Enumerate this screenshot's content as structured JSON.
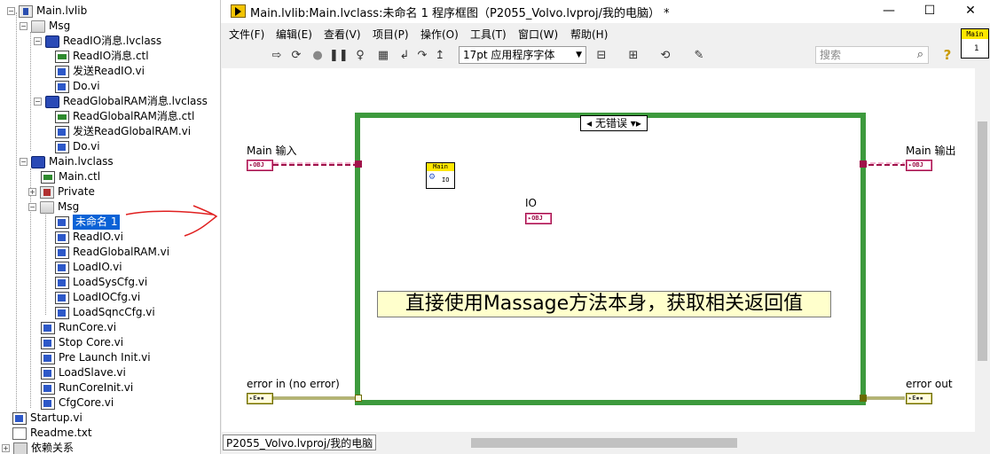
{
  "tree": {
    "items": [
      {
        "label": "Main.lvlib"
      },
      {
        "label": "Msg"
      },
      {
        "label": "ReadIO消息.lvclass"
      },
      {
        "label": "ReadIO消息.ctl"
      },
      {
        "label": "发送ReadIO.vi"
      },
      {
        "label": "Do.vi"
      },
      {
        "label": "ReadGlobalRAM消息.lvclass"
      },
      {
        "label": "ReadGlobalRAM消息.ctl"
      },
      {
        "label": "发送ReadGlobalRAM.vi"
      },
      {
        "label": "Do.vi"
      },
      {
        "label": "Main.lvclass"
      },
      {
        "label": "Main.ctl"
      },
      {
        "label": "Private"
      },
      {
        "label": "Msg"
      },
      {
        "label": "未命名 1"
      },
      {
        "label": "ReadIO.vi"
      },
      {
        "label": "ReadGlobalRAM.vi"
      },
      {
        "label": "LoadIO.vi"
      },
      {
        "label": "LoadSysCfg.vi"
      },
      {
        "label": "LoadIOCfg.vi"
      },
      {
        "label": "LoadSqncCfg.vi"
      },
      {
        "label": "RunCore.vi"
      },
      {
        "label": "Stop Core.vi"
      },
      {
        "label": "Pre Launch Init.vi"
      },
      {
        "label": "LoadSlave.vi"
      },
      {
        "label": "RunCoreInit.vi"
      },
      {
        "label": "CfgCore.vi"
      },
      {
        "label": "Startup.vi"
      },
      {
        "label": "Readme.txt"
      },
      {
        "label": "依赖关系"
      }
    ]
  },
  "window": {
    "title": "Main.lvlib:Main.lvclass:未命名 1 程序框图（P2055_Volvo.lvproj/我的电脑）  *",
    "minimize": "—",
    "maximize": "☐",
    "close": "✕"
  },
  "menubar": {
    "items": [
      "文件(F)",
      "编辑(E)",
      "查看(V)",
      "项目(P)",
      "操作(O)",
      "工具(T)",
      "窗口(W)",
      "帮助(H)"
    ]
  },
  "toolbar": {
    "font": "17pt 应用程序字体",
    "search_placeholder": "搜索",
    "help": "?"
  },
  "vi_icon": {
    "header": "Main",
    "number": "1"
  },
  "diagram": {
    "case_selector": "◂ 无错误 ▾▸",
    "main_in_label": "Main 输入",
    "main_out_label": "Main 输出",
    "error_in_label": "error in (no error)",
    "error_out_label": "error out",
    "io_label": "IO",
    "obj_tag": "▸OBJ",
    "err_tag": "▸E▪▪",
    "method_header": "Main",
    "method_io": "IO",
    "note": "直接使用Massage方法本身，获取相关返回值"
  },
  "status": {
    "path": "P2055_Volvo.lvproj/我的电脑"
  },
  "colors": {
    "case_border": "#3d9a3d",
    "obj_wire": "#a0124a",
    "error_wire": "#6a6a00",
    "selection": "#0a62d6",
    "annotation_red": "#e02020"
  }
}
